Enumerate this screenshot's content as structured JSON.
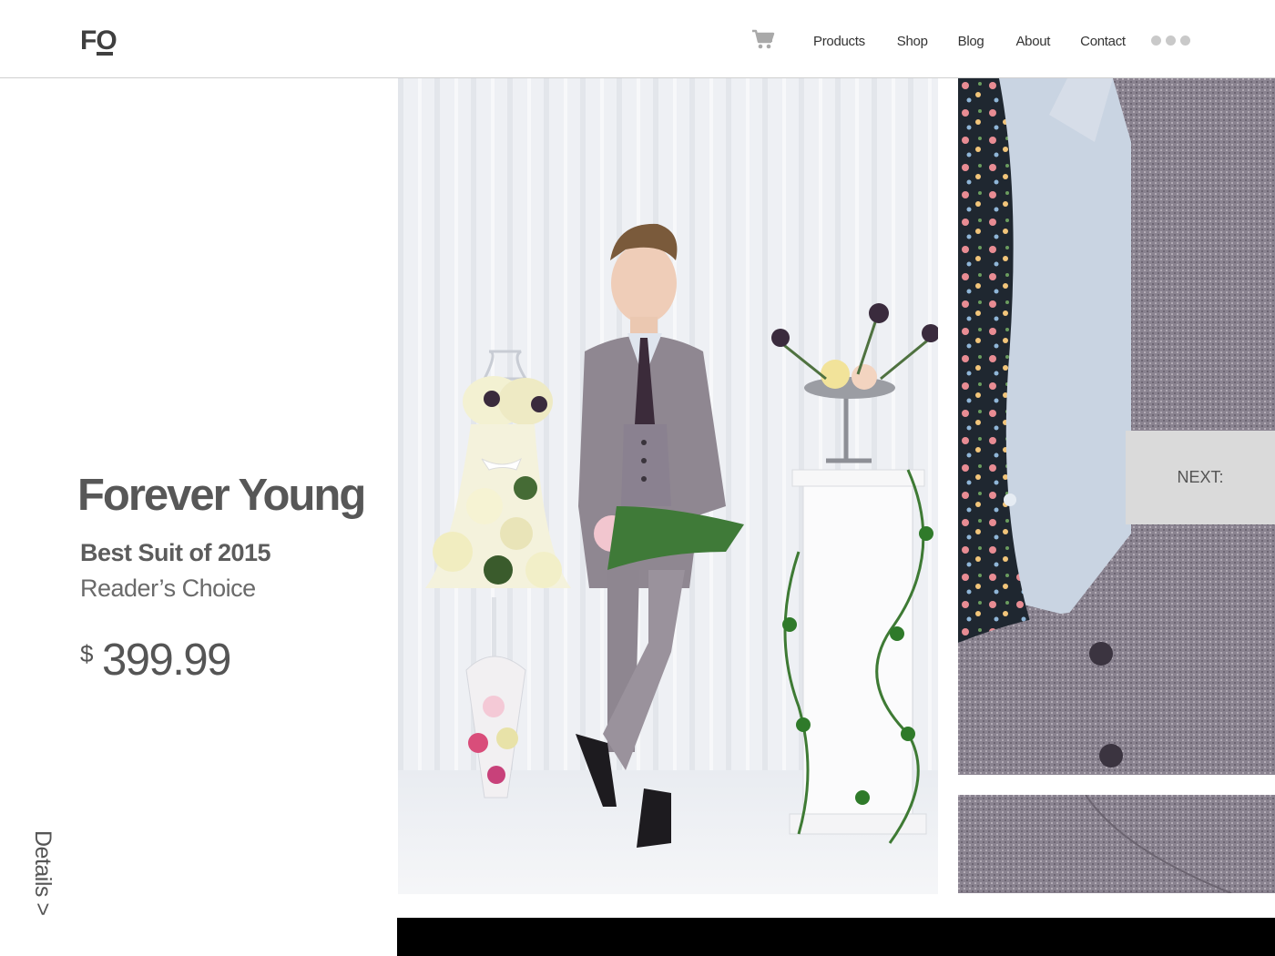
{
  "header": {
    "logo_text": "FO",
    "nav": [
      "Products",
      "Shop",
      "Blog",
      "About",
      "Contact"
    ],
    "cart_icon": "cart-icon",
    "more_icon": "three-dots-icon"
  },
  "product": {
    "title": "Forever Young",
    "award": "Best Suit of 2015",
    "subaward": "Reader’s Choice",
    "currency": "$",
    "price": "399.99",
    "details_link": "Details >"
  },
  "gallery": {
    "next_label": "NEXT:"
  },
  "colors": {
    "text": "#555555",
    "suit": "#8b8490",
    "next_bg": "#dadada",
    "bar": "#000000"
  }
}
